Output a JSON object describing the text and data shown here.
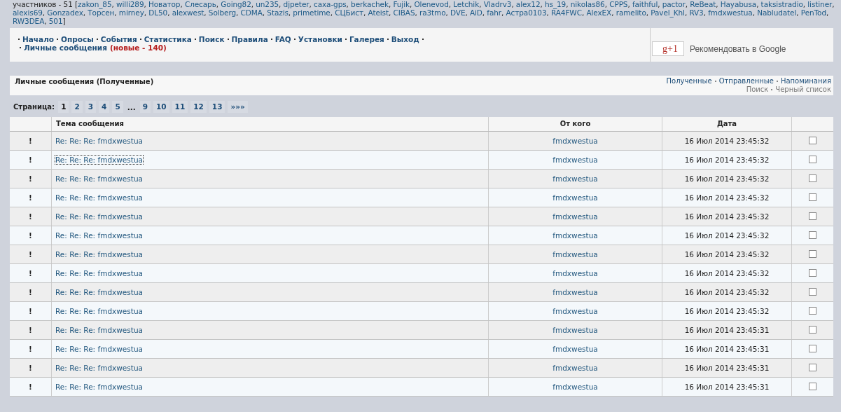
{
  "online_users": {
    "prefix": "участников - 51 [",
    "names": [
      "zakon_85",
      "willi289",
      "Новатор",
      "Слесарь",
      "Going82",
      "un235",
      "djpeter",
      "саха-gps",
      "berkachek",
      "Fujik",
      "Olenevod",
      "Letchik",
      "Vladrv3",
      "alex12",
      "hs_19",
      "nikolas86",
      "CPPS",
      "faithful",
      "pactor",
      "ReBeat",
      "Hayabusa",
      "taksistradio",
      "listiner",
      "alexis69",
      "Gonzadex",
      "Торсен",
      "mirney",
      "DL50",
      "alexwest",
      "Solberg",
      "CDMA",
      "Stazis",
      "primetime",
      "СЦБист",
      "Ateist",
      "CIBAS",
      "ra3tmo",
      "DVE",
      "AiD",
      "fahr",
      "Астра0103",
      "RA4FWC",
      "AlexEX",
      "ramelito",
      "Pavel_Khl",
      "RV3",
      "fmdxwestua",
      "Nabludatel",
      "PenTod",
      "RW3DEA",
      "501"
    ],
    "separator": ", ",
    "suffix": "]"
  },
  "nav": {
    "items": [
      "Начало",
      "Опросы",
      "События",
      "Статистика",
      "Поиск",
      "Правила",
      "FAQ",
      "Установки",
      "Галерея",
      "Выход"
    ],
    "messages_link": "Личные сообщения",
    "new_count": "(новые - 140)"
  },
  "google": {
    "button": "g+1",
    "caption": "Рекомендовать в Google"
  },
  "section": {
    "title": "Личные сообщения (Полученные)",
    "folders": [
      "Полученные",
      "Отправленные",
      "Напоминания"
    ],
    "tools": [
      "Поиск",
      "Черный список"
    ]
  },
  "pager": {
    "label": "Страница:",
    "pages": [
      {
        "kind": "page",
        "text": "1",
        "selected": true
      },
      {
        "kind": "page",
        "text": "2",
        "selected": false
      },
      {
        "kind": "page",
        "text": "3",
        "selected": false
      },
      {
        "kind": "page",
        "text": "4",
        "selected": false
      },
      {
        "kind": "page",
        "text": "5",
        "selected": false
      },
      {
        "kind": "gap",
        "text": "..."
      },
      {
        "kind": "page",
        "text": "9",
        "selected": false
      },
      {
        "kind": "page",
        "text": "10",
        "selected": false
      },
      {
        "kind": "page",
        "text": "11",
        "selected": false
      },
      {
        "kind": "page",
        "text": "12",
        "selected": false
      },
      {
        "kind": "page",
        "text": "13",
        "selected": false
      },
      {
        "kind": "page",
        "text": "»»»",
        "selected": false
      }
    ]
  },
  "table": {
    "columns": [
      "",
      "Тема сообщения",
      "От кого",
      "Дата",
      ""
    ],
    "rows": [
      {
        "flag": "!",
        "subject": "Re: Re: Re: fmdxwestua",
        "focused": false,
        "from": "fmdxwestua",
        "date": "16 Июл 2014 23:45:32",
        "checked": false
      },
      {
        "flag": "!",
        "subject": "Re: Re: Re: fmdxwestua",
        "focused": true,
        "from": "fmdxwestua",
        "date": "16 Июл 2014 23:45:32",
        "checked": false
      },
      {
        "flag": "!",
        "subject": "Re: Re: Re: fmdxwestua",
        "focused": false,
        "from": "fmdxwestua",
        "date": "16 Июл 2014 23:45:32",
        "checked": false
      },
      {
        "flag": "!",
        "subject": "Re: Re: Re: fmdxwestua",
        "focused": false,
        "from": "fmdxwestua",
        "date": "16 Июл 2014 23:45:32",
        "checked": false
      },
      {
        "flag": "!",
        "subject": "Re: Re: Re: fmdxwestua",
        "focused": false,
        "from": "fmdxwestua",
        "date": "16 Июл 2014 23:45:32",
        "checked": false
      },
      {
        "flag": "!",
        "subject": "Re: Re: Re: fmdxwestua",
        "focused": false,
        "from": "fmdxwestua",
        "date": "16 Июл 2014 23:45:32",
        "checked": false
      },
      {
        "flag": "!",
        "subject": "Re: Re: Re: fmdxwestua",
        "focused": false,
        "from": "fmdxwestua",
        "date": "16 Июл 2014 23:45:32",
        "checked": false
      },
      {
        "flag": "!",
        "subject": "Re: Re: Re: fmdxwestua",
        "focused": false,
        "from": "fmdxwestua",
        "date": "16 Июл 2014 23:45:32",
        "checked": false
      },
      {
        "flag": "!",
        "subject": "Re: Re: Re: fmdxwestua",
        "focused": false,
        "from": "fmdxwestua",
        "date": "16 Июл 2014 23:45:32",
        "checked": false
      },
      {
        "flag": "!",
        "subject": "Re: Re: Re: fmdxwestua",
        "focused": false,
        "from": "fmdxwestua",
        "date": "16 Июл 2014 23:45:32",
        "checked": false
      },
      {
        "flag": "!",
        "subject": "Re: Re: Re: fmdxwestua",
        "focused": false,
        "from": "fmdxwestua",
        "date": "16 Июл 2014 23:45:31",
        "checked": false
      },
      {
        "flag": "!",
        "subject": "Re: Re: Re: fmdxwestua",
        "focused": false,
        "from": "fmdxwestua",
        "date": "16 Июл 2014 23:45:31",
        "checked": false
      },
      {
        "flag": "!",
        "subject": "Re: Re: Re: fmdxwestua",
        "focused": false,
        "from": "fmdxwestua",
        "date": "16 Июл 2014 23:45:31",
        "checked": false
      },
      {
        "flag": "!",
        "subject": "Re: Re: Re: fmdxwestua",
        "focused": false,
        "from": "fmdxwestua",
        "date": "16 Июл 2014 23:45:31",
        "checked": false
      }
    ]
  }
}
